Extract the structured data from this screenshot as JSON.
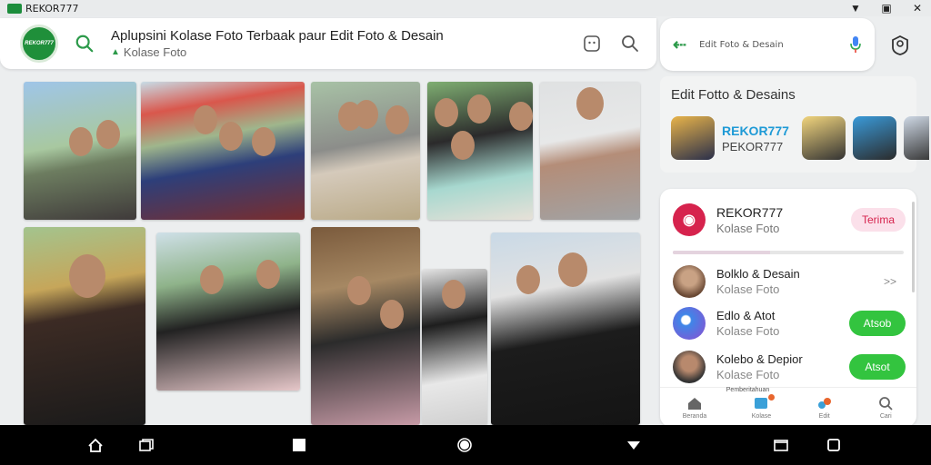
{
  "window": {
    "title": "REKOR777"
  },
  "header": {
    "logo_text": "REKOR777",
    "title": "Aplupsini Kolase Foto Terbaak paur Edit Foto & Desain",
    "subtitle": "Kolase Foto"
  },
  "search": {
    "placeholder": "Edit Foto & Desain"
  },
  "section": {
    "title": "Edit Fotto & Desains",
    "featured_brand": "REKOR777",
    "featured_sub": "PEKOR777"
  },
  "list": {
    "top": {
      "title": "REKOR777",
      "subtitle": "Kolase Foto",
      "button": "Terima",
      "progress": 0.42
    },
    "rows": [
      {
        "title": "Bolklo & Desain",
        "subtitle": "Kolase Foto",
        "action": "share"
      },
      {
        "title": "Edlo & Atot",
        "subtitle": "Kolase Foto",
        "action": "Atsob"
      },
      {
        "title": "Kolebo & Depior",
        "subtitle": "Kolase Foto",
        "action": "Atsot"
      }
    ]
  },
  "tabs": [
    {
      "label": "Beranda",
      "icon": "home-icon"
    },
    {
      "label": "Kolase",
      "icon": "collage-icon",
      "badge_text": "Pemberitahuan"
    },
    {
      "label": "Edit",
      "icon": "edit-icon"
    },
    {
      "label": "Cari",
      "icon": "search-icon"
    }
  ],
  "colors": {
    "brand_green": "#1f8f3a",
    "accent_pink": "#d6234d",
    "button_green": "#33c43f"
  }
}
